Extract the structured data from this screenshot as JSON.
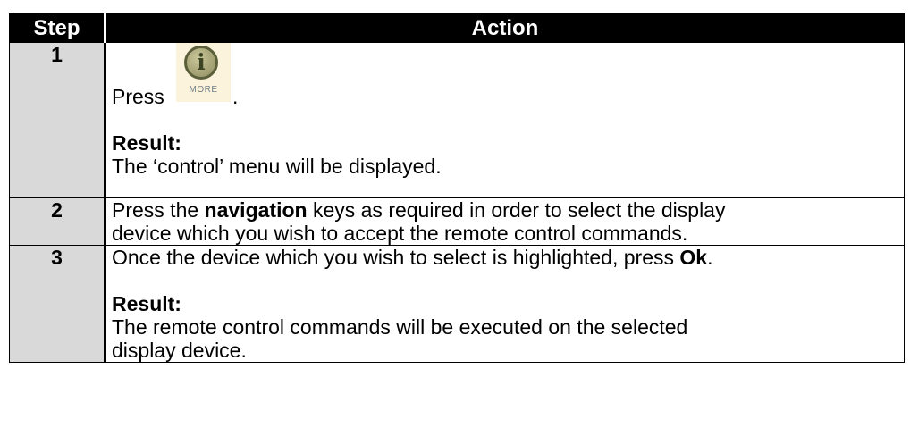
{
  "table": {
    "headers": {
      "step": "Step",
      "action": "Action"
    },
    "rows": [
      {
        "step": "1",
        "press_prefix": "Press ",
        "press_suffix": ".",
        "result_label": "Result:",
        "result_text": "The ‘control’ menu will be displayed."
      },
      {
        "step": "2",
        "text_1": "Press the ",
        "bold_1": "navigation",
        "text_2": " keys as required in order to select the display",
        "line_2": "device which you wish to accept the remote control commands."
      },
      {
        "step": "3",
        "text_1": "Once the device which you wish to select is highlighted, press ",
        "bold_1": "Ok",
        "text_2": ".",
        "result_label": "Result:",
        "result_line_1": "The remote control commands will be executed on the selected",
        "result_line_2": "display device."
      }
    ]
  },
  "more_button": {
    "glyph": "i",
    "label": "MORE",
    "icon": "info-more-icon"
  }
}
